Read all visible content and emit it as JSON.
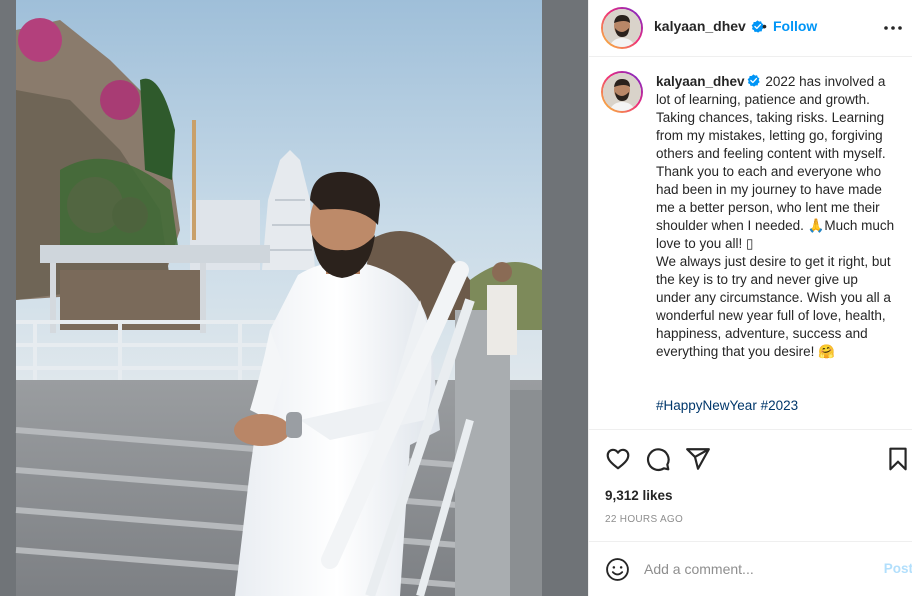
{
  "post": {
    "username": "kalyaan_dhev",
    "verified": true,
    "follow_label": "Follow",
    "separator": "•",
    "caption_user": "kalyaan_dhev",
    "caption_text": " 2022 has involved a lot of learning, patience and growth. Taking chances, taking risks. Learning from my mistakes, letting go, forgiving others and feeling content with myself. Thank you to each and everyone who had been in my journey to have made me a better person, who lent me their shoulder when I needed. 🙏Much much love to you all! ▯\nWe always just desire to get it right, but the key is to try and never give up under any circumstance. Wish you all a wonderful new year full of love, health, happiness, adventure, success and everything that you desire! 🤗",
    "hashtags": [
      "#HappyNewYear",
      "#2023"
    ],
    "likes": "9,312 likes",
    "time": "22 HOURS AGO"
  },
  "comment": {
    "placeholder": "Add a comment...",
    "post_label": "Post"
  },
  "icons": {
    "more": "more-horizontal-icon",
    "like": "heart-icon",
    "comment": "comment-icon",
    "share": "send-icon",
    "save": "bookmark-icon",
    "emoji": "emoji-icon",
    "verified": "verified-badge-icon"
  },
  "colors": {
    "link_blue": "#0095f6",
    "hashtag": "#00376b",
    "muted": "#8e8e8e",
    "post_disabled": "#b2dffc"
  }
}
